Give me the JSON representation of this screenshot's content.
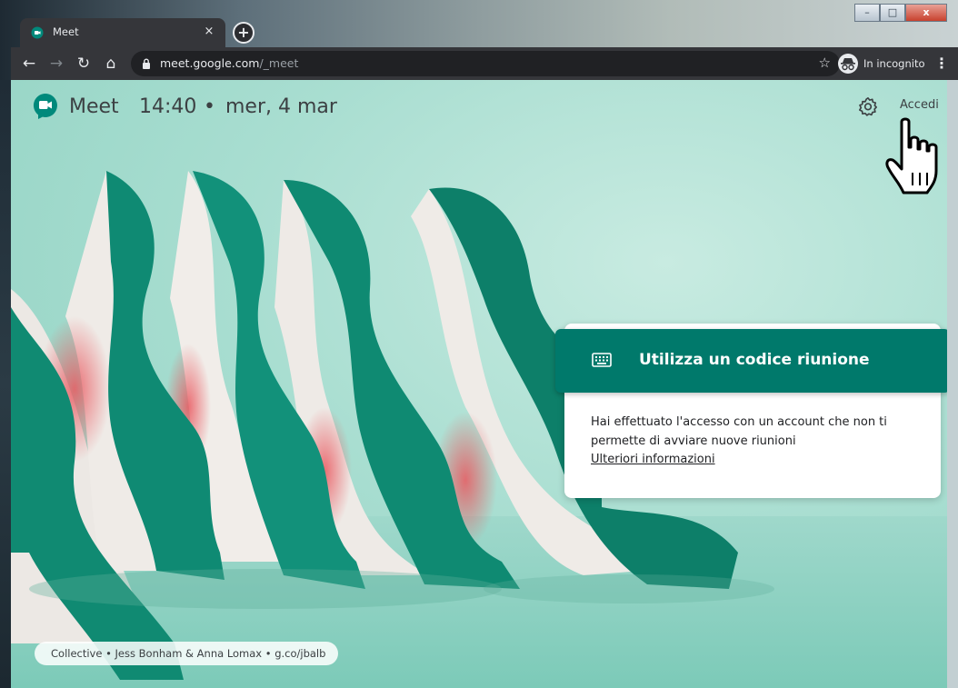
{
  "browser": {
    "tab_title": "Meet",
    "tab_close": "×",
    "new_tab": "+",
    "url_host": "meet.google.com",
    "url_path": "/_meet",
    "incognito_label": "In incognito",
    "window_controls": [
      "–",
      "□",
      "x"
    ]
  },
  "header": {
    "brand": "Meet",
    "time": "14:40",
    "separator": "•",
    "date": "mer, 4 mar",
    "signin": "Accedi"
  },
  "card": {
    "code_button_label": "Utilizza un codice riunione",
    "message": "Hai effettuato l'accesso con un account che non ti permette di avviare nuove riunioni",
    "link": "Ulteriori informazioni"
  },
  "credit": "Collective • Jess Bonham & Anna Lomax • g.co/jbalb",
  "colors": {
    "accent": "#00796b",
    "chrome_dark": "#35363a",
    "background_mint": "#a9ded1",
    "wave_green": "#0f8a72",
    "wave_white": "#eeeae6",
    "shadow_red": "#e86a6f"
  }
}
